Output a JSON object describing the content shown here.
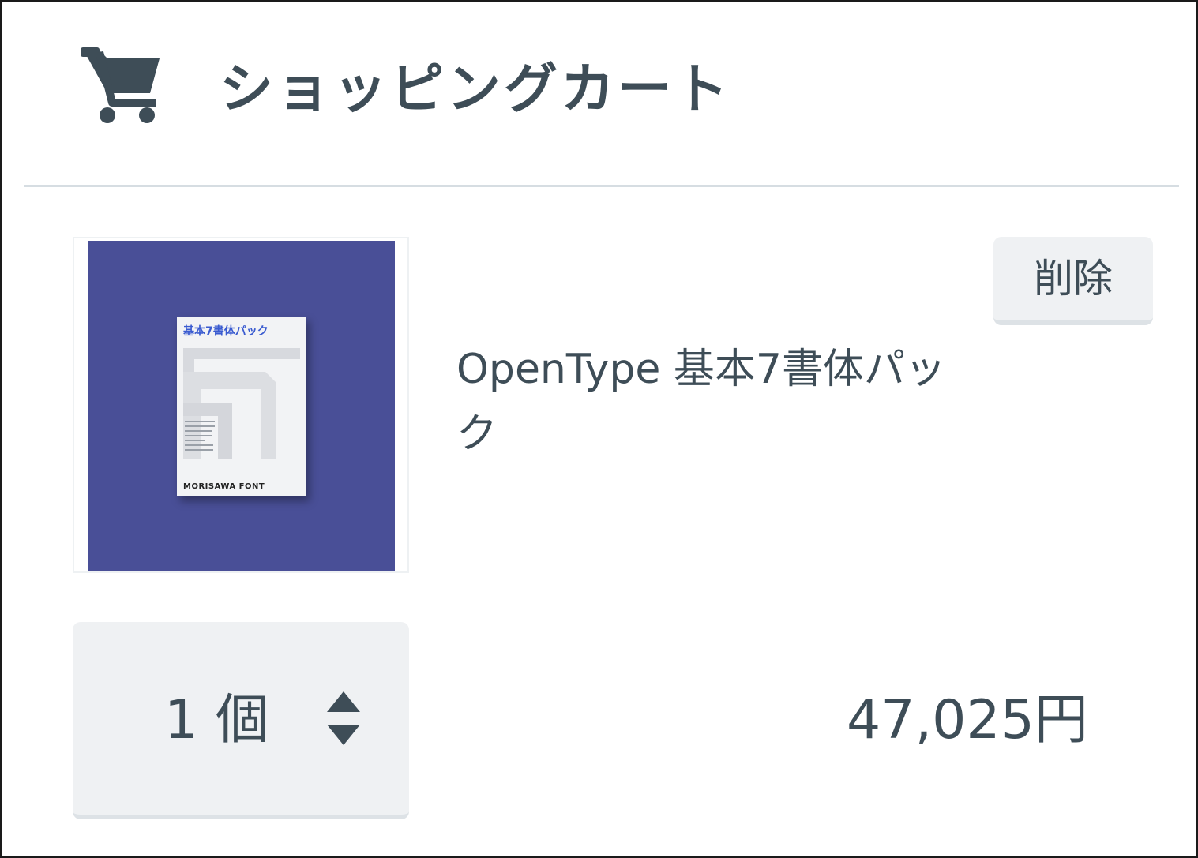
{
  "header": {
    "icon": "shopping-cart-icon",
    "title": "ショッピングカート"
  },
  "cart": {
    "items": [
      {
        "image": {
          "package_title": "基本7書体パック",
          "package_brand": "MORISAWA FONT",
          "background_color": "#494f97"
        },
        "name": "OpenType 基本7書体パック",
        "delete_label": "削除",
        "quantity_label": "1 個",
        "quantity_icon": "sort-updown-icon",
        "price": "47,025円"
      }
    ]
  }
}
